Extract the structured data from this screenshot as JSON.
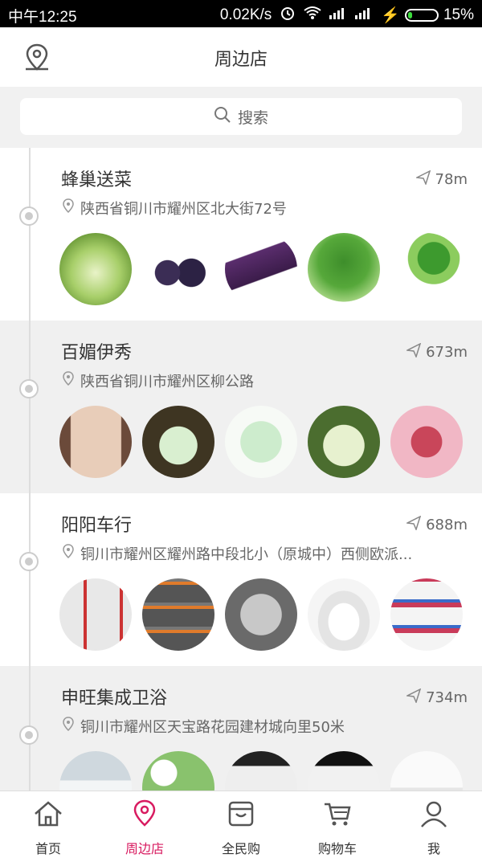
{
  "status_bar": {
    "time": "中午12:25",
    "speed": "0.02K/s",
    "battery": "15%",
    "battery_level": 0.15,
    "accent": "#3ddc3d"
  },
  "header": {
    "title": "周边店",
    "location_icon": "location-pin-icon"
  },
  "search": {
    "placeholder": "搜索"
  },
  "stores": [
    {
      "name": "蜂巢送菜",
      "distance": "78m",
      "address": "陕西省铜川市耀州区北大街72号",
      "thumbs": [
        "cabbage",
        "purple-eggplant-round",
        "purple-eggplant-long",
        "cilantro",
        "celery"
      ]
    },
    {
      "name": "百媚伊秀",
      "distance": "673m",
      "address": "陕西省铜川市耀州区柳公路",
      "thumbs": [
        "models",
        "pads-green",
        "pads-pack",
        "pads-box",
        "lingerie"
      ]
    },
    {
      "name": "阳阳车行",
      "distance": "688m",
      "address": "铜川市耀州区耀州路中段北小（原城中）西侧欧派...",
      "thumbs": [
        "scooter-catalog",
        "ebike-catalog",
        "small-car",
        "white-scooter",
        "scooter-grid"
      ]
    },
    {
      "name": "申旺集成卫浴",
      "distance": "734m",
      "address": "铜川市耀州区天宝路花园建材城向里50米",
      "thumbs": [
        "bath-1",
        "bath-2",
        "bath-3",
        "bath-4",
        "bath-5"
      ]
    }
  ],
  "tabs": [
    {
      "label": "首页",
      "icon": "home-icon"
    },
    {
      "label": "周边店",
      "icon": "location-pin-icon",
      "active": true
    },
    {
      "label": "全民购",
      "icon": "shop-bag-icon"
    },
    {
      "label": "购物车",
      "icon": "cart-icon"
    },
    {
      "label": "我",
      "icon": "user-icon"
    }
  ],
  "colors": {
    "active_tab": "#d81b60",
    "text": "#333333",
    "muted": "#666666"
  }
}
